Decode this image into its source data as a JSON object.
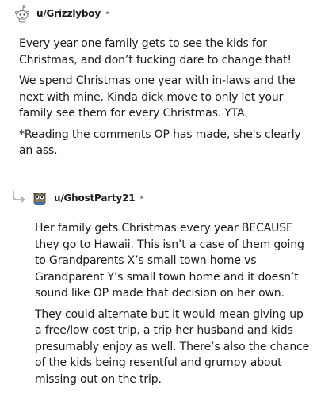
{
  "comments": [
    {
      "username": "u/Grizzlyboy",
      "separator": "•",
      "avatar_icon": "snoo-avatar-icon",
      "paragraphs": [
        "Every year one family gets to see the kids for Christmas, and don’t fucking dare to change that!",
        "We spend Christmas one year with in-laws and the next with mine. Kinda dick move to only let your family see them for every Christmas. YTA.",
        "*Reading the comments OP has made, she's clearly an ass."
      ]
    },
    {
      "username": "u/GhostParty21",
      "separator": "•",
      "avatar_icon": "owl-avatar-icon",
      "reply_icon": "reply-arrow-icon",
      "paragraphs": [
        "Her family gets Christmas every year BECAUSE they go to Hawaii. This isn’t a case of them going to Grandparents X’s small town home vs Grandparent Y’s small town home and it doesn’t sound like OP made that decision on her own.",
        "They could alternate but it would mean giving up a free/low cost trip, a trip her husband and kids presumably enjoy as well. There’s also the chance of the kids being resentful and grumpy about missing out on the trip."
      ]
    }
  ],
  "colors": {
    "text": "#1c1c1c",
    "meta": "#878a8c",
    "reply_line": "#a7a7a7"
  }
}
